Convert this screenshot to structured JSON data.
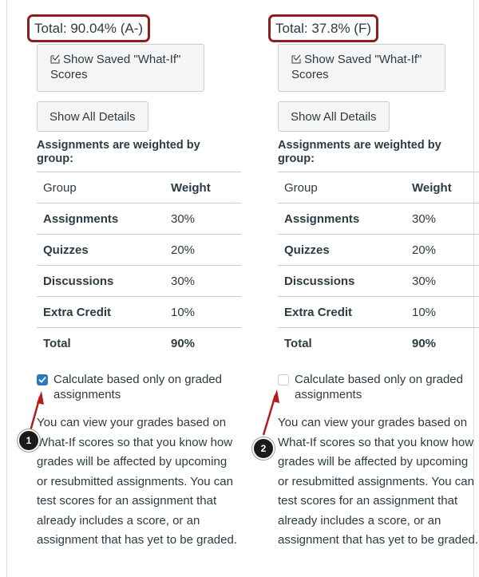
{
  "columns": [
    {
      "total": "Total: 90.04% (A-)",
      "whatif_button": "Show Saved \"What-If\" Scores",
      "details_button": "Show All Details",
      "weighted_heading": "Assignments are weighted by group:",
      "table": {
        "headers": [
          "Group",
          "Weight"
        ],
        "rows": [
          {
            "group": "Assignments",
            "weight": "30%"
          },
          {
            "group": "Quizzes",
            "weight": "20%"
          },
          {
            "group": "Discussions",
            "weight": "30%"
          },
          {
            "group": "Extra Credit",
            "weight": "10%"
          },
          {
            "group": "Total",
            "weight": "90%"
          }
        ]
      },
      "calc_checkbox": {
        "label": "Calculate based only on graded assignments",
        "checked": true
      },
      "description": "You can view your grades based on What-If scores so that you know how grades will be affected by upcoming or resubmitted assignments. You can test scores for an assignment that already includes a score, or an assignment that has yet to be graded.",
      "marker": "1"
    },
    {
      "total": "Total: 37.8% (F)",
      "whatif_button": "Show Saved \"What-If\" Scores",
      "details_button": "Show All Details",
      "weighted_heading": "Assignments are weighted by group:",
      "table": {
        "headers": [
          "Group",
          "Weight"
        ],
        "rows": [
          {
            "group": "Assignments",
            "weight": "30%"
          },
          {
            "group": "Quizzes",
            "weight": "20%"
          },
          {
            "group": "Discussions",
            "weight": "30%"
          },
          {
            "group": "Extra Credit",
            "weight": "10%"
          },
          {
            "group": "Total",
            "weight": "90%"
          }
        ]
      },
      "calc_checkbox": {
        "label": "Calculate based only on graded assignments",
        "checked": false
      },
      "description": "You can view your grades based on What-If scores so that you know how grades will be affected by upcoming or resubmitted assignments. You can test scores for an assignment that already includes a score, or an assignment that has yet to be graded.",
      "marker": "2"
    }
  ],
  "colors": {
    "highlight_border": "#8f1d1d",
    "checkbox_checked": "#2b7abc",
    "arrow": "#b01e1e",
    "text": "#2d3b45"
  },
  "icons": {
    "whatif": "whatif-scores-icon",
    "checkmark": "checkmark-icon"
  }
}
